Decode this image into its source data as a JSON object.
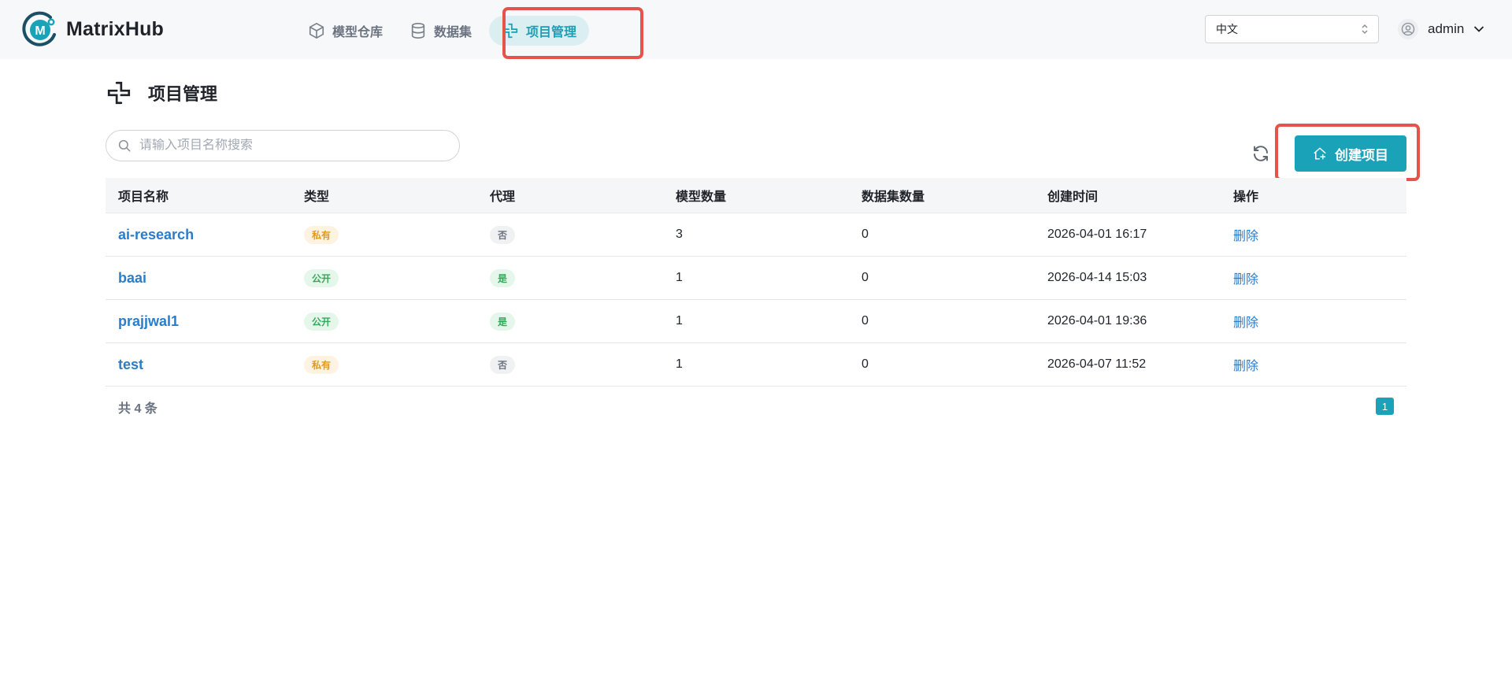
{
  "app": {
    "name": "MatrixHub"
  },
  "nav": {
    "items": [
      {
        "label": "模型仓库",
        "icon": "cube-icon"
      },
      {
        "label": "数据集",
        "icon": "database-icon"
      },
      {
        "label": "项目管理",
        "icon": "project-icon",
        "active": true
      }
    ]
  },
  "header": {
    "language": "中文",
    "user": "admin"
  },
  "page": {
    "title": "项目管理",
    "search_placeholder": "请输入项目名称搜索",
    "create_label": "创建项目"
  },
  "table": {
    "columns": [
      "项目名称",
      "类型",
      "代理",
      "模型数量",
      "数据集数量",
      "创建时间",
      "操作"
    ],
    "rows": [
      {
        "name": "ai-research",
        "type": "私有",
        "type_kind": "private",
        "proxy": "否",
        "proxy_kind": "no",
        "models": "3",
        "datasets": "0",
        "created": "2026-04-01 16:17",
        "action": "删除"
      },
      {
        "name": "baai",
        "type": "公开",
        "type_kind": "public",
        "proxy": "是",
        "proxy_kind": "yes",
        "models": "1",
        "datasets": "0",
        "created": "2026-04-14 15:03",
        "action": "删除"
      },
      {
        "name": "prajjwal1",
        "type": "公开",
        "type_kind": "public",
        "proxy": "是",
        "proxy_kind": "yes",
        "models": "1",
        "datasets": "0",
        "created": "2026-04-01 19:36",
        "action": "删除"
      },
      {
        "name": "test",
        "type": "私有",
        "type_kind": "private",
        "proxy": "否",
        "proxy_kind": "no",
        "models": "1",
        "datasets": "0",
        "created": "2026-04-07 11:52",
        "action": "删除"
      }
    ]
  },
  "pagination": {
    "total_text": "共 4 条",
    "current_page": "1"
  },
  "colors": {
    "accent": "#1aa3b8",
    "link": "#2b7cc9",
    "highlight": "#e5534b"
  }
}
